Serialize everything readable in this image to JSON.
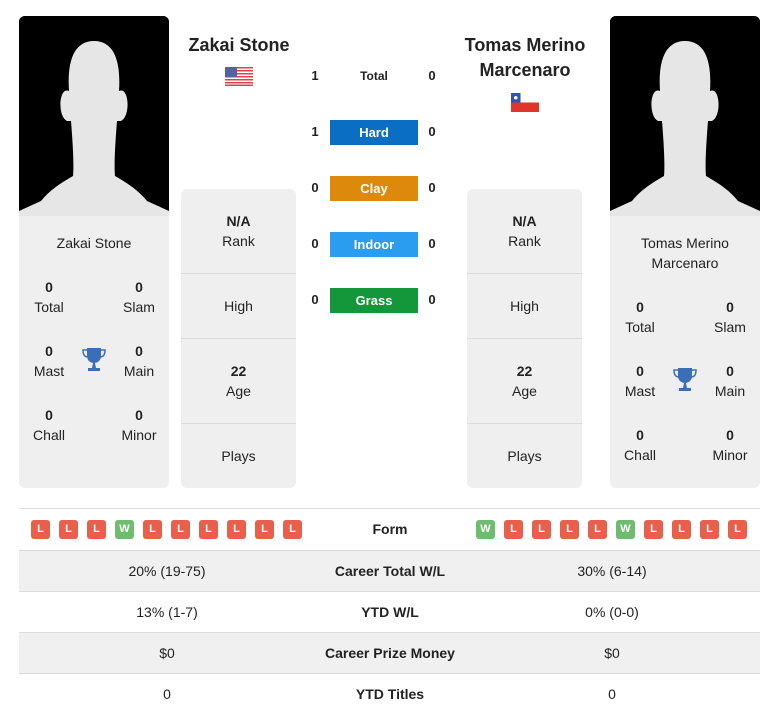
{
  "players": {
    "left": {
      "name": "Zakai Stone",
      "country_flag": "usa-flag-icon",
      "titles": {
        "total": "0",
        "slam": "0",
        "mast": "0",
        "main": "0",
        "chall": "0",
        "minor": "0"
      },
      "info": {
        "rank_value": "N/A",
        "rank_label": "Rank",
        "high_label": "High",
        "age_value": "22",
        "age_label": "Age",
        "plays_label": "Plays"
      },
      "form": [
        "L",
        "L",
        "L",
        "W",
        "L",
        "L",
        "L",
        "L",
        "L",
        "L"
      ]
    },
    "right": {
      "name": "Tomas Merino Marcenaro",
      "name_line1": "Tomas Merino",
      "name_line2": "Marcenaro",
      "country_flag": "chile-flag-icon",
      "titles": {
        "total": "0",
        "slam": "0",
        "mast": "0",
        "main": "0",
        "chall": "0",
        "minor": "0"
      },
      "info": {
        "rank_value": "N/A",
        "rank_label": "Rank",
        "high_label": "High",
        "age_value": "22",
        "age_label": "Age",
        "plays_label": "Plays"
      },
      "form": [
        "W",
        "L",
        "L",
        "L",
        "L",
        "W",
        "L",
        "L",
        "L",
        "L"
      ]
    }
  },
  "title_labels": {
    "total": "Total",
    "slam": "Slam",
    "mast": "Mast",
    "main": "Main",
    "chall": "Chall",
    "minor": "Minor"
  },
  "h2h": [
    {
      "label": "Total",
      "left": "1",
      "right": "0",
      "color": ""
    },
    {
      "label": "Hard",
      "left": "1",
      "right": "0",
      "color": "#0a6ec2"
    },
    {
      "label": "Clay",
      "left": "0",
      "right": "0",
      "color": "#dd8a0c"
    },
    {
      "label": "Indoor",
      "left": "0",
      "right": "0",
      "color": "#2b9df1"
    },
    {
      "label": "Grass",
      "left": "0",
      "right": "0",
      "color": "#14973a"
    }
  ],
  "form_label": "Form",
  "comparison": [
    {
      "label": "Career Total W/L",
      "left": "20% (19-75)",
      "right": "30% (6-14)"
    },
    {
      "label": "YTD W/L",
      "left": "13% (1-7)",
      "right": "0% (0-0)"
    },
    {
      "label": "Career Prize Money",
      "left": "$0",
      "right": "$0"
    },
    {
      "label": "YTD Titles",
      "left": "0",
      "right": "0"
    }
  ],
  "colors": {
    "win": "#6ebd6e",
    "loss": "#e8604c",
    "trophy": "#3a6fb8"
  }
}
